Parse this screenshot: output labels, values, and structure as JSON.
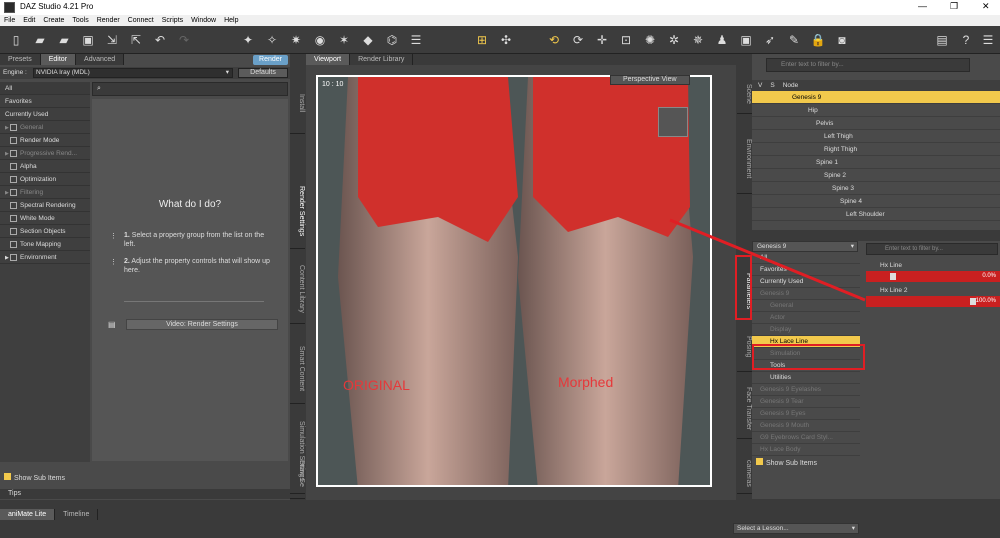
{
  "window": {
    "title": "DAZ Studio 4.21 Pro",
    "controls": [
      "—",
      "❐",
      "✕"
    ]
  },
  "menu": [
    "File",
    "Edit",
    "Create",
    "Tools",
    "Render",
    "Connect",
    "Scripts",
    "Window",
    "Help"
  ],
  "left": {
    "tabs": [
      "Presets",
      "Editor",
      "Advanced"
    ],
    "render_button": "Render",
    "engine_label": "Engine :",
    "engine_value": "NVIDIA Iray (MDL)",
    "defaults_button": "Defaults",
    "groups": [
      "All",
      "Favorites",
      "Currently Used",
      "General",
      "Render Mode",
      "Progressive Rend...",
      "Alpha",
      "Optimization",
      "Filtering",
      "Spectral Rendering",
      "White Mode",
      "Section Objects",
      "Tone Mapping",
      "Environment"
    ],
    "what_title": "What do I do?",
    "step1": "Select a property group from the list on the left.",
    "step2": "Adjust the property controls that will show up here.",
    "step1_num": "1.",
    "step2_num": "2.",
    "video_button": "Video: Render Settings",
    "show_sub": "Show Sub Items",
    "tips_tab": "Tips"
  },
  "left_vtabs": [
    "Install",
    "Render Settings",
    "Content Library",
    "Smart Content",
    "Simulation Settings",
    "Draw Se"
  ],
  "viewport": {
    "tabs": [
      "Viewport",
      "Render Library"
    ],
    "view": "Perspective View",
    "aspect": "10 : 10",
    "label_left": "ORIGINAL",
    "label_right": "Morphed"
  },
  "scene": {
    "filter_placeholder": "Enter text to filter by...",
    "cols": [
      "V",
      "S",
      "Node"
    ],
    "nodes": [
      "Genesis 9",
      "Hip",
      "Pelvis",
      "Left Thigh",
      "Right Thigh",
      "Spine 1",
      "Spine 2",
      "Spine 3",
      "Spine 4",
      "Left Shoulder"
    ]
  },
  "right_vtabs": [
    "Scene",
    "Environment",
    "Parameters",
    "Posing",
    "Face Transfer",
    "cameras"
  ],
  "params": {
    "figure": "Genesis 9",
    "filter_placeholder": "Enter text to filter by...",
    "groups": [
      "All",
      "Favorites",
      "Currently Used",
      "Genesis 9",
      "General",
      "Actor",
      "Display",
      "Hx Lace Line",
      "Simulation",
      "Tools",
      "Utilities",
      "Genesis 9 Eyelashes",
      "Genesis 9 Tear",
      "Genesis 9 Eyes",
      "Genesis 9 Mouth",
      "G9 Eyebrows Card Styl...",
      "Hx Lace Body"
    ],
    "show_sub": "Show Sub Items",
    "slider1_label": "Hx Line",
    "slider1_value": "0.0%",
    "slider1_level": 0.0,
    "slider2_label": "Hx Line 2",
    "slider2_value": "100.0%",
    "slider2_level": 1.0
  },
  "bottom": {
    "tabs": [
      "aniMate Lite",
      "Timeline"
    ],
    "lesson": "Select a Lesson..."
  },
  "colors": {
    "accent": "#f2c94c",
    "highlight": "#e01e24"
  }
}
